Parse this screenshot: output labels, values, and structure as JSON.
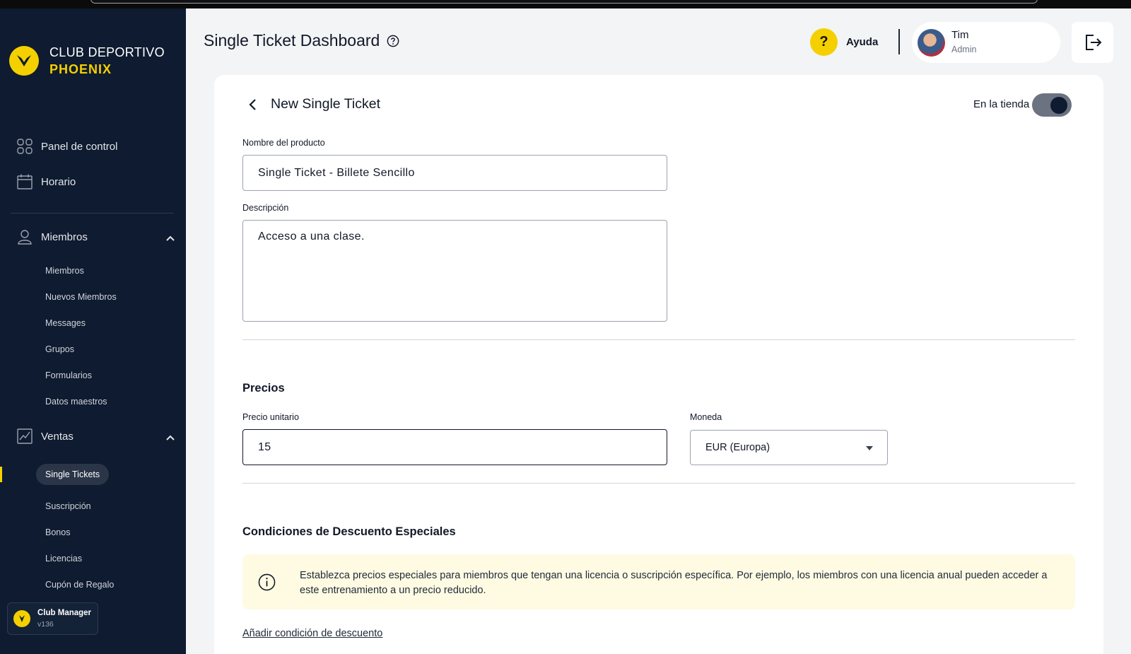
{
  "brand": {
    "line1": "CLUB DEPORTIVO",
    "line2": "PHOENIX"
  },
  "sidebar": {
    "nav": [
      {
        "label": "Panel de control"
      },
      {
        "label": "Horario"
      }
    ],
    "miembros": {
      "label": "Miembros",
      "items": [
        "Miembros",
        "Nuevos Miembros",
        "Messages",
        "Grupos",
        "Formularios",
        "Datos maestros"
      ]
    },
    "ventas": {
      "label": "Ventas",
      "items": [
        "Single Tickets",
        "Suscripción",
        "Bonos",
        "Licencias",
        "Cupón de Regalo"
      ]
    },
    "badge": {
      "name": "Club Manager",
      "version": "v136"
    }
  },
  "header": {
    "title": "Single Ticket Dashboard",
    "help_label": "Ayuda",
    "user": {
      "name": "Tim",
      "role": "Admin"
    }
  },
  "form": {
    "title": "New Single Ticket",
    "store_toggle_label": "En la tienda",
    "store_toggle_on": true,
    "product_name_label": "Nombre del producto",
    "product_name_value": "Single Ticket - Billete Sencillo",
    "description_label": "Descripción",
    "description_value": "Acceso a una clase.",
    "pricing_section": "Precios",
    "unit_price_label": "Precio unitario",
    "unit_price_value": "15",
    "currency_label": "Moneda",
    "currency_value": "EUR (Europa)",
    "discount_section": "Condiciones de Descuento Especiales",
    "discount_info": "Establezca precios especiales para miembros que tengan una licencia o suscripción específica. Por ejemplo, los miembros con una licencia anual pueden acceder a este entrenamiento a un precio reducido.",
    "add_discount_link": "Añadir condición de descuento"
  },
  "colors": {
    "sidebar_bg": "#0e1b30",
    "accent": "#f5d000",
    "info_bg": "#fffbe3"
  }
}
